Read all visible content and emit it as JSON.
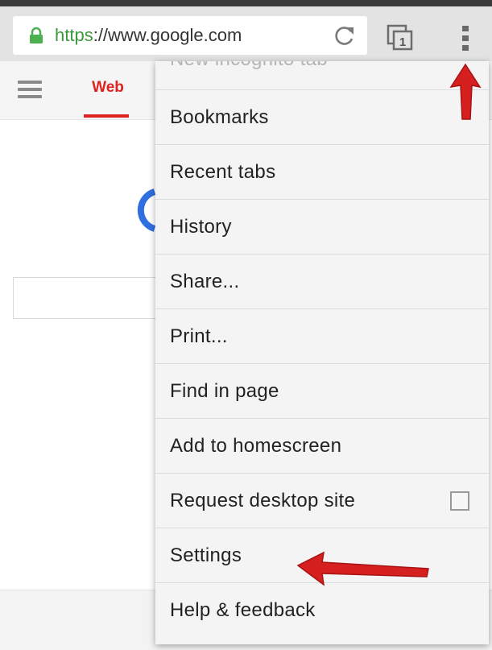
{
  "address_bar": {
    "url_scheme": "https",
    "url_rest": "://www.google.com"
  },
  "toolbar": {
    "tab_count": "1"
  },
  "nav": {
    "web_tab_label": "Web"
  },
  "menu": {
    "partial_item_label": "New incognito tab",
    "items": [
      {
        "label": "Bookmarks"
      },
      {
        "label": "Recent tabs"
      },
      {
        "label": "History"
      },
      {
        "label": "Share..."
      },
      {
        "label": "Print..."
      },
      {
        "label": "Find in page"
      },
      {
        "label": "Add to homescreen"
      },
      {
        "label": "Request desktop site",
        "checked": false
      },
      {
        "label": "Settings"
      },
      {
        "label": "Help & feedback"
      }
    ]
  },
  "colors": {
    "accent_red": "#dd2222",
    "secure_green": "#3a9a3a",
    "annotation_arrow": "#d61f1f"
  },
  "icons": {
    "lock": "lock-icon",
    "reload": "reload-icon",
    "tabs": "tab-switcher-icon",
    "menu": "overflow-menu-icon",
    "hamburger": "hamburger-icon"
  }
}
